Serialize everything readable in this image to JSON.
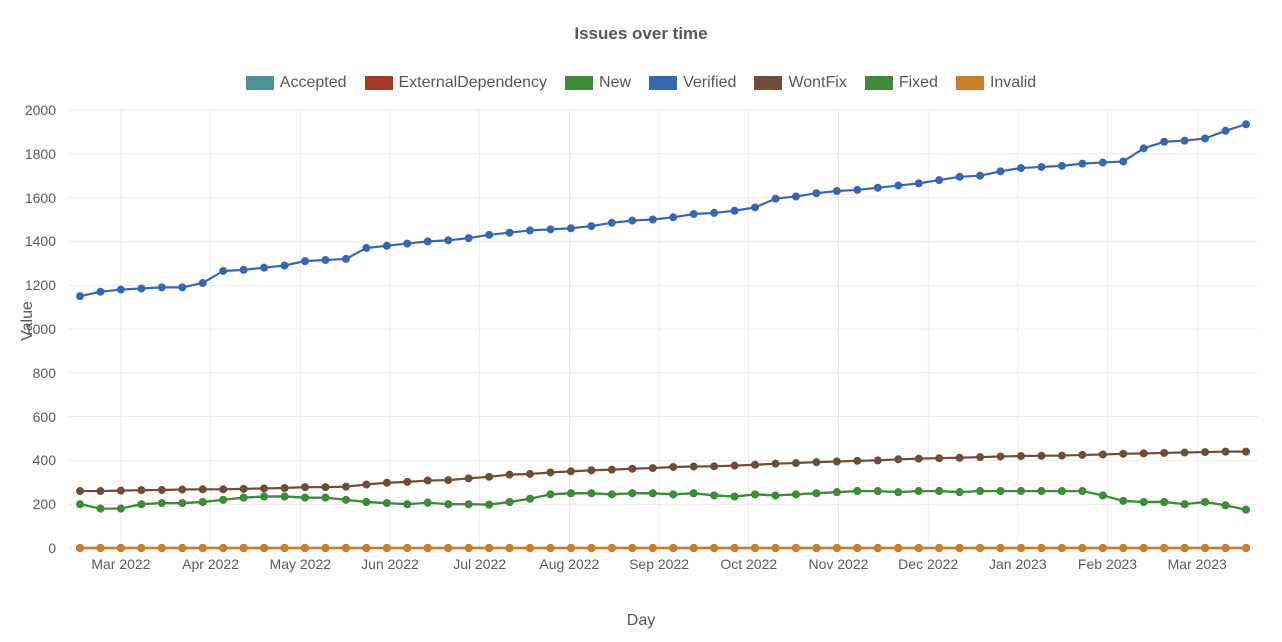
{
  "chart_data": {
    "type": "line",
    "title": "Issues over time",
    "xlabel": "Day",
    "ylabel": "Value",
    "ylim": [
      0,
      2000
    ],
    "yticks": [
      0,
      200,
      400,
      600,
      800,
      1000,
      1200,
      1400,
      1600,
      1800,
      2000
    ],
    "xticks": [
      "Mar 2022",
      "Apr 2022",
      "May 2022",
      "Jun 2022",
      "Jul 2022",
      "Aug 2022",
      "Sep 2022",
      "Oct 2022",
      "Nov 2022",
      "Dec 2022",
      "Jan 2023",
      "Feb 2023",
      "Mar 2023"
    ],
    "x": [
      0,
      1,
      2,
      3,
      4,
      5,
      6,
      7,
      8,
      9,
      10,
      11,
      12,
      13,
      14,
      15,
      16,
      17,
      18,
      19,
      20,
      21,
      22,
      23,
      24,
      25,
      26,
      27,
      28,
      29,
      30,
      31,
      32,
      33,
      34,
      35,
      36,
      37,
      38,
      39,
      40,
      41,
      42,
      43,
      44,
      45,
      46,
      47,
      48,
      49,
      50,
      51,
      52,
      53,
      54,
      55,
      56,
      57
    ],
    "series": [
      {
        "name": "Accepted",
        "color": "#4c9193",
        "values": [
          0,
          0,
          0,
          0,
          0,
          0,
          0,
          0,
          0,
          0,
          0,
          0,
          0,
          0,
          0,
          0,
          0,
          0,
          0,
          0,
          0,
          0,
          0,
          0,
          0,
          0,
          0,
          0,
          0,
          0,
          0,
          0,
          0,
          0,
          0,
          0,
          0,
          0,
          0,
          0,
          0,
          0,
          0,
          0,
          0,
          0,
          0,
          0,
          0,
          0,
          0,
          0,
          0,
          0,
          0,
          0,
          0,
          0
        ]
      },
      {
        "name": "ExternalDependency",
        "color": "#a33a2c",
        "values": [
          0,
          0,
          0,
          0,
          0,
          0,
          0,
          0,
          0,
          0,
          0,
          0,
          0,
          0,
          0,
          0,
          0,
          0,
          0,
          0,
          0,
          0,
          0,
          0,
          0,
          0,
          0,
          0,
          0,
          0,
          0,
          0,
          0,
          0,
          0,
          0,
          0,
          0,
          0,
          0,
          0,
          0,
          0,
          0,
          0,
          0,
          0,
          0,
          0,
          0,
          0,
          0,
          0,
          0,
          0,
          0,
          0,
          0
        ]
      },
      {
        "name": "New",
        "color": "#3f8b3a",
        "values": [
          200,
          180,
          180,
          200,
          205,
          205,
          210,
          220,
          230,
          235,
          235,
          230,
          230,
          220,
          210,
          205,
          200,
          207,
          200,
          200,
          198,
          210,
          225,
          245,
          250,
          250,
          245,
          250,
          250,
          245,
          250,
          240,
          235,
          245,
          240,
          245,
          250,
          255,
          260,
          260,
          255,
          260,
          260,
          255,
          260,
          260,
          260,
          260,
          260,
          260,
          240,
          215,
          210,
          210,
          200,
          210,
          195,
          175
        ]
      },
      {
        "name": "Verified",
        "color": "#3867b1",
        "values": [
          1150,
          1170,
          1180,
          1185,
          1190,
          1190,
          1210,
          1265,
          1270,
          1280,
          1290,
          1310,
          1315,
          1320,
          1370,
          1380,
          1390,
          1400,
          1405,
          1415,
          1430,
          1440,
          1450,
          1455,
          1460,
          1470,
          1485,
          1495,
          1500,
          1510,
          1525,
          1530,
          1540,
          1555,
          1595,
          1605,
          1620,
          1630,
          1635,
          1645,
          1655,
          1665,
          1680,
          1695,
          1700,
          1720,
          1735,
          1740,
          1745,
          1755,
          1760,
          1765,
          1825,
          1855,
          1860,
          1870,
          1905,
          1935
        ]
      },
      {
        "name": "WontFix",
        "color": "#6e4d39",
        "values": [
          260,
          260,
          262,
          264,
          265,
          267,
          268,
          268,
          270,
          272,
          274,
          278,
          278,
          280,
          290,
          298,
          302,
          308,
          310,
          318,
          325,
          335,
          338,
          345,
          350,
          355,
          358,
          362,
          365,
          370,
          372,
          373,
          376,
          380,
          385,
          388,
          392,
          395,
          398,
          400,
          405,
          408,
          410,
          412,
          415,
          418,
          420,
          421,
          422,
          425,
          427,
          430,
          432,
          434,
          436,
          438,
          440,
          440
        ]
      },
      {
        "name": "Fixed",
        "color": "#3f8b3a",
        "values": [
          200,
          180,
          180,
          200,
          205,
          205,
          210,
          220,
          230,
          235,
          235,
          230,
          230,
          220,
          210,
          205,
          200,
          207,
          200,
          200,
          198,
          210,
          225,
          245,
          250,
          250,
          245,
          250,
          250,
          245,
          250,
          240,
          235,
          245,
          240,
          245,
          250,
          255,
          260,
          260,
          255,
          260,
          260,
          255,
          260,
          260,
          260,
          260,
          260,
          260,
          240,
          215,
          210,
          210,
          200,
          210,
          195,
          175
        ]
      },
      {
        "name": "Invalid",
        "color": "#c97f2a",
        "values": [
          0,
          0,
          0,
          0,
          0,
          0,
          0,
          0,
          0,
          0,
          0,
          0,
          0,
          0,
          0,
          0,
          0,
          0,
          0,
          0,
          0,
          0,
          0,
          0,
          0,
          0,
          0,
          0,
          0,
          0,
          0,
          0,
          0,
          0,
          0,
          0,
          0,
          0,
          0,
          0,
          0,
          0,
          0,
          0,
          0,
          0,
          0,
          0,
          0,
          0,
          0,
          0,
          0,
          0,
          0,
          0,
          0,
          0
        ]
      }
    ],
    "legend_position": "top"
  },
  "legend_labels": {
    "accepted": "Accepted",
    "externaldep": "ExternalDependency",
    "new": "New",
    "verified": "Verified",
    "wontfix": "WontFix",
    "fixed": "Fixed",
    "invalid": "Invalid"
  }
}
